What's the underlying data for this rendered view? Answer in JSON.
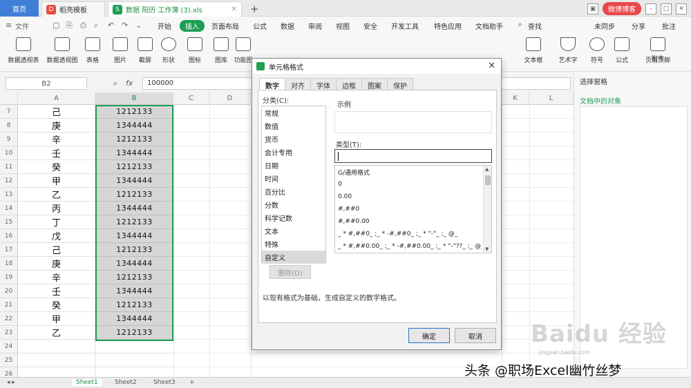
{
  "titlebar": {
    "home_tab": "首页",
    "tabs": [
      {
        "label": "稻壳模板",
        "badge": "D",
        "color": "#e84c3d"
      },
      {
        "label": "数据 阳历 工作簿 (3).xls",
        "badge": "S",
        "color": "#1f9e54"
      }
    ],
    "new_tab": "+",
    "user": "微博博客"
  },
  "menubar": {
    "quick_actions": [
      "文件",
      "≡"
    ],
    "items": [
      "开始",
      "插入",
      "页面布局",
      "公式",
      "数据",
      "审阅",
      "视图",
      "安全",
      "开发工具",
      "特色应用",
      "文档助手"
    ],
    "active": "插入",
    "search": "查找",
    "right": [
      "未同步",
      "分享",
      "批注"
    ]
  },
  "ribbon": {
    "left_buttons": [
      "数据透视表",
      "数据透视图",
      "表格",
      "图片",
      "截屏",
      "形状",
      "图标",
      "图库",
      "功能图"
    ],
    "right_buttons": [
      "文本框",
      "艺术字",
      "符号",
      "公式",
      "页眉页脚",
      "附件"
    ]
  },
  "formula_bar": {
    "cell_ref": "B2",
    "fx": "fx",
    "value": "100000"
  },
  "grid": {
    "columns": [
      "A",
      "B",
      "C",
      "D",
      "E",
      "F",
      "G",
      "H",
      "I",
      "J",
      "K",
      "L"
    ],
    "rows": [
      {
        "num": "7",
        "a": "己",
        "b": "1212133"
      },
      {
        "num": "8",
        "a": "庚",
        "b": "1344444"
      },
      {
        "num": "9",
        "a": "辛",
        "b": "1212133"
      },
      {
        "num": "10",
        "a": "壬",
        "b": "1344444"
      },
      {
        "num": "11",
        "a": "癸",
        "b": "1212133"
      },
      {
        "num": "12",
        "a": "甲",
        "b": "1344444"
      },
      {
        "num": "13",
        "a": "乙",
        "b": "1212133"
      },
      {
        "num": "14",
        "a": "丙",
        "b": "1344444"
      },
      {
        "num": "15",
        "a": "丁",
        "b": "1212133"
      },
      {
        "num": "16",
        "a": "戊",
        "b": "1344444"
      },
      {
        "num": "17",
        "a": "己",
        "b": "1212133"
      },
      {
        "num": "18",
        "a": "庚",
        "b": "1344444"
      },
      {
        "num": "19",
        "a": "辛",
        "b": "1212133"
      },
      {
        "num": "20",
        "a": "壬",
        "b": "1344444"
      },
      {
        "num": "21",
        "a": "癸",
        "b": "1212133"
      },
      {
        "num": "22",
        "a": "甲",
        "b": "1344444"
      },
      {
        "num": "23",
        "a": "乙",
        "b": "1212133"
      },
      {
        "num": "24",
        "a": "",
        "b": ""
      },
      {
        "num": "25",
        "a": "",
        "b": ""
      },
      {
        "num": "26",
        "a": "",
        "b": ""
      }
    ]
  },
  "sheets": [
    "Sheet1",
    "Sheet2",
    "Sheet3",
    "+"
  ],
  "right_pane": {
    "title": "选择窗格",
    "subtitle": "文档中的对象"
  },
  "dialog": {
    "title": "单元格格式",
    "tabs": [
      "数字",
      "对齐",
      "字体",
      "边框",
      "图案",
      "保护"
    ],
    "category_label": "分类(C):",
    "categories": [
      "常规",
      "数值",
      "货币",
      "会计专用",
      "日期",
      "时间",
      "百分比",
      "分数",
      "科学记数",
      "文本",
      "特殊",
      "自定义"
    ],
    "selected_category": "自定义",
    "sample_label": "示例",
    "type_label": "类型(T):",
    "type_value": "",
    "type_list": [
      "G/通用格式",
      "0",
      "0.00",
      "#,##0",
      "#,##0.00",
      "_ * #,##0_ ;_ * -#,##0_ ;_ * \"-\"_ ;_ @_",
      "_ * #,##0.00_ ;_ * -#,##0.00_ ;_ * \"-\"??_ ;_ @_"
    ],
    "delete_label": "删除(D)",
    "description": "以现有格式为基础，生成自定义的数字格式。",
    "ok_label": "确定",
    "cancel_label": "取消"
  },
  "watermarks": {
    "baidu": "Baidu 经验",
    "small": "jingyan.baidu.com",
    "author": "头条 @职场Excel幽竹丝梦"
  },
  "colors": {
    "accent": "#1f9e54",
    "home_tab": "#3f7fd8",
    "user_pill": "#e9484a"
  }
}
